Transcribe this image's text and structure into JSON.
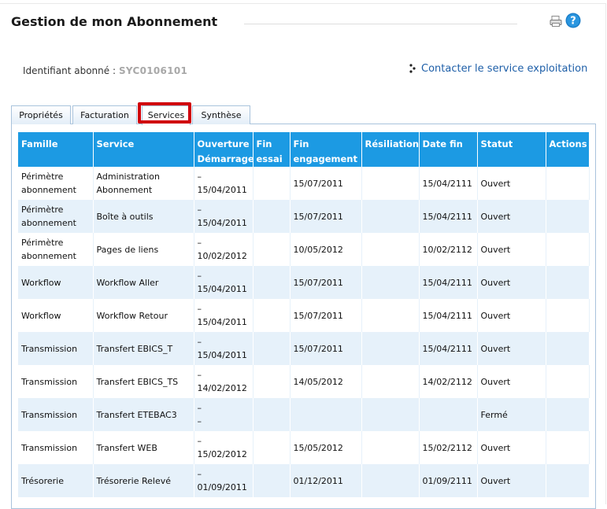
{
  "header": {
    "title": "Gestion de mon Abonnement",
    "print_icon": "print-icon",
    "help_icon": "help-icon"
  },
  "subscriber": {
    "label": "Identifiant abonné :",
    "value": "SYC0106101"
  },
  "contact_link": {
    "label": "Contacter le service exploitation",
    "icon": "dots-icon"
  },
  "tabs": [
    {
      "label": "Propriétés"
    },
    {
      "label": "Facturation"
    },
    {
      "label": "Services",
      "active": true
    },
    {
      "label": "Synthèse"
    }
  ],
  "table": {
    "headers": [
      "Famille",
      "Service",
      "Ouverture Démarrage",
      "Fin essai",
      "Fin engagement",
      "Résiliation",
      "Date fin",
      "Statut",
      "Actions"
    ],
    "header_lines": [
      [
        "Famille"
      ],
      [
        "Service"
      ],
      [
        "Ouverture",
        "Démarrage"
      ],
      [
        "Fin",
        "essai"
      ],
      [
        "Fin",
        "engagement"
      ],
      [
        "Résiliation"
      ],
      [
        "Date fin"
      ],
      [
        "Statut"
      ],
      [
        "Actions"
      ]
    ],
    "rows": [
      {
        "famille": [
          "Périmètre",
          "abonnement"
        ],
        "service": [
          "Administration",
          "Abonnement"
        ],
        "ouverture": [
          "–",
          "15/04/2011"
        ],
        "fin_essai": "",
        "fin_engagement": "15/07/2011",
        "resiliation": "",
        "date_fin": "15/04/2111",
        "statut": "Ouvert",
        "actions": ""
      },
      {
        "famille": [
          "Périmètre",
          "abonnement"
        ],
        "service": [
          "Boîte à outils"
        ],
        "ouverture": [
          "–",
          "15/04/2011"
        ],
        "fin_essai": "",
        "fin_engagement": "15/07/2011",
        "resiliation": "",
        "date_fin": "15/04/2111",
        "statut": "Ouvert",
        "actions": ""
      },
      {
        "famille": [
          "Périmètre",
          "abonnement"
        ],
        "service": [
          "Pages de liens"
        ],
        "ouverture": [
          "–",
          "10/02/2012"
        ],
        "fin_essai": "",
        "fin_engagement": "10/05/2012",
        "resiliation": "",
        "date_fin": "10/02/2112",
        "statut": "Ouvert",
        "actions": ""
      },
      {
        "famille": [
          "Workflow"
        ],
        "service": [
          "Workflow Aller"
        ],
        "ouverture": [
          "–",
          "15/04/2011"
        ],
        "fin_essai": "",
        "fin_engagement": "15/07/2011",
        "resiliation": "",
        "date_fin": "15/04/2111",
        "statut": "Ouvert",
        "actions": ""
      },
      {
        "famille": [
          "Workflow"
        ],
        "service": [
          "Workflow Retour"
        ],
        "ouverture": [
          "–",
          "15/04/2011"
        ],
        "fin_essai": "",
        "fin_engagement": "15/07/2011",
        "resiliation": "",
        "date_fin": "15/04/2111",
        "statut": "Ouvert",
        "actions": ""
      },
      {
        "famille": [
          "Transmission"
        ],
        "service": [
          "Transfert EBICS_T"
        ],
        "ouverture": [
          "–",
          "15/04/2011"
        ],
        "fin_essai": "",
        "fin_engagement": "15/07/2011",
        "resiliation": "",
        "date_fin": "15/04/2111",
        "statut": "Ouvert",
        "actions": ""
      },
      {
        "famille": [
          "Transmission"
        ],
        "service": [
          "Transfert EBICS_TS"
        ],
        "ouverture": [
          "–",
          "14/02/2012"
        ],
        "fin_essai": "",
        "fin_engagement": "14/05/2012",
        "resiliation": "",
        "date_fin": "14/02/2112",
        "statut": "Ouvert",
        "actions": ""
      },
      {
        "famille": [
          "Transmission"
        ],
        "service": [
          "Transfert ETEBAC3"
        ],
        "ouverture": [
          "–",
          "–"
        ],
        "fin_essai": "",
        "fin_engagement": "",
        "resiliation": "",
        "date_fin": "",
        "statut": "Fermé",
        "actions": ""
      },
      {
        "famille": [
          "Transmission"
        ],
        "service": [
          "Transfert WEB"
        ],
        "ouverture": [
          "–",
          "15/02/2012"
        ],
        "fin_essai": "",
        "fin_engagement": "15/05/2012",
        "resiliation": "",
        "date_fin": "15/02/2112",
        "statut": "Ouvert",
        "actions": ""
      },
      {
        "famille": [
          "Trésorerie"
        ],
        "service": [
          "Trésorerie Relevé"
        ],
        "ouverture": [
          "–",
          "01/09/2011"
        ],
        "fin_essai": "",
        "fin_engagement": "01/12/2011",
        "resiliation": "",
        "date_fin": "01/09/2111",
        "statut": "Ouvert",
        "actions": ""
      }
    ]
  },
  "colors": {
    "header_bg": "#1c9ae3",
    "row_alt_bg": "#e6f1fa",
    "link": "#1e5fa8",
    "highlight": "#d0000a",
    "tab_border": "#a9c3dc"
  }
}
